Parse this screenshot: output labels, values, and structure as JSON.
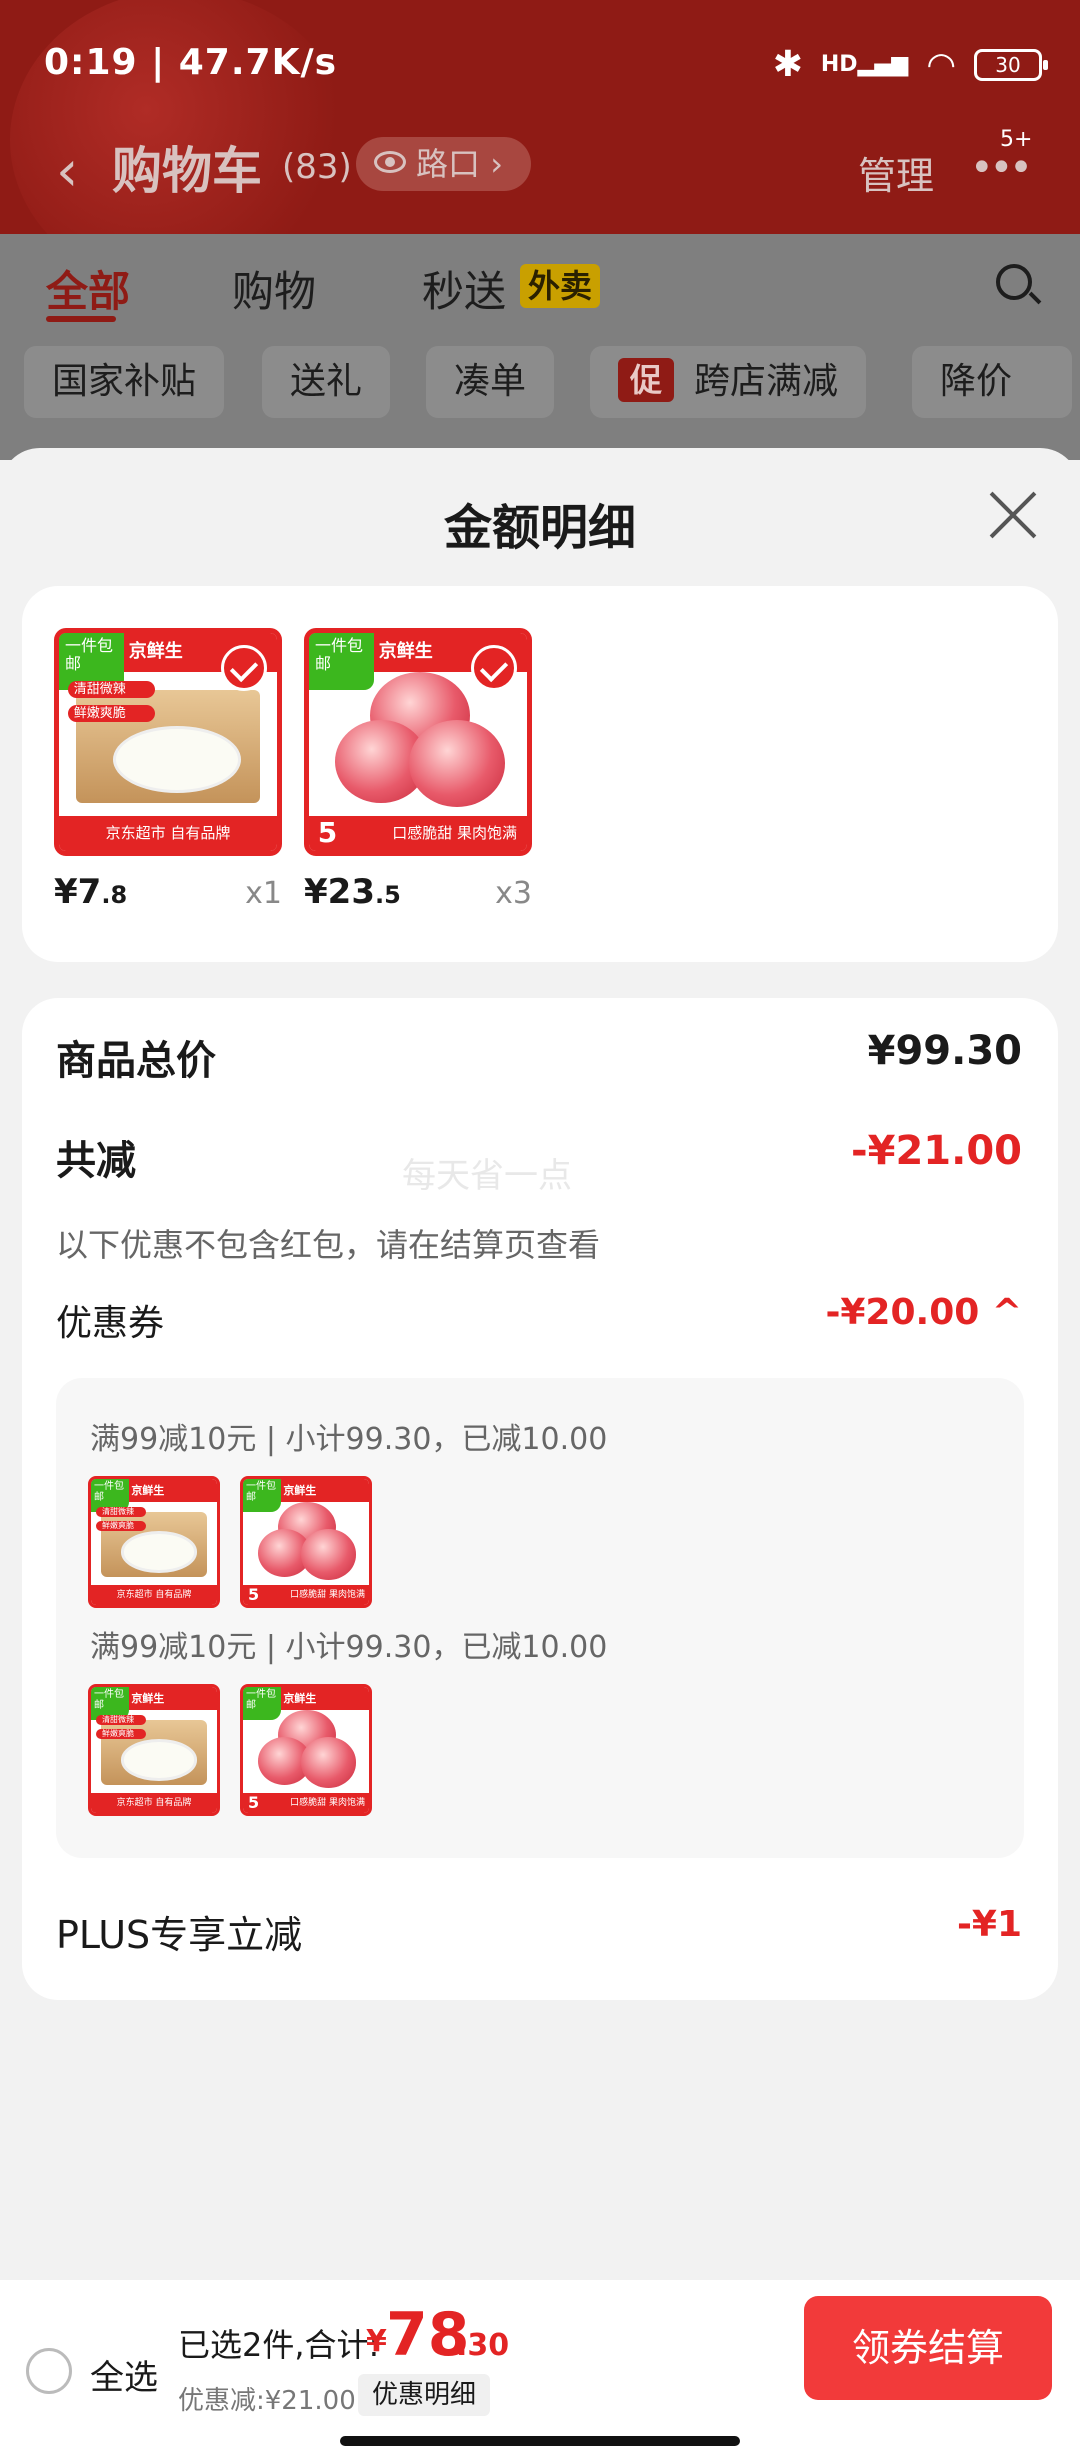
{
  "status_bar": {
    "time": "0:19 | 47.7K/s",
    "network": "HD",
    "battery": "30"
  },
  "header": {
    "back_label": "‹",
    "title": "购物车",
    "count": "(83)",
    "location": "路口",
    "manage": "管理",
    "more": "•••",
    "badge": "5+"
  },
  "tabs": [
    {
      "label": "全部",
      "active": true
    },
    {
      "label": "购物",
      "active": false
    },
    {
      "label": "秒送",
      "active": false
    }
  ],
  "tab_badge": "外卖",
  "filters": [
    "国家补贴",
    "送礼",
    "凑单",
    "跨店满减",
    "降价"
  ],
  "filter_promo_icon": "促",
  "sheet": {
    "title": "金额明细",
    "products": [
      {
        "name": "radish",
        "brand": "京鲜生",
        "tag": "一件包邮",
        "footer": "京东超市 自有品牌",
        "label1": "清甜微辣",
        "label2": "鲜嫩爽脆",
        "price_int": "¥7",
        "price_dec": ".8",
        "qty": "x1"
      },
      {
        "name": "apple",
        "brand": "京鲜生",
        "tag": "一件包邮",
        "footer": "口感脆甜 果肉饱满",
        "weight": "5",
        "price_int": "¥23",
        "price_dec": ".5",
        "qty": "x3"
      }
    ],
    "total_label": "商品总价",
    "total_value": "¥99.30",
    "discount_label": "共减",
    "discount_value": "-¥21.00",
    "watermark": "每天省一点",
    "discount_note": "以下优惠不包含红包，请在结算页查看",
    "coupon_label": "优惠券",
    "coupon_value": "-¥20.00 ^",
    "coupon_lines": [
      "满99减10元 | 小计99.30，已减10.00",
      "满99减10元 | 小计99.30，已减10.00"
    ],
    "plus_label": "PLUS专享立减",
    "plus_value": "-¥1"
  },
  "bottom_bar": {
    "select_all": "全选",
    "summary": "已选2件,合计:",
    "total_yen": "¥",
    "total_int": "78",
    "total_dec": ".30",
    "saved": "优惠减:¥21.00",
    "detail_button": "优惠明细",
    "checkout_button": "领券结算"
  },
  "colors": {
    "accent": "#e32424",
    "header_bg": "#8f1b15",
    "checkout": "#f23a3a"
  }
}
